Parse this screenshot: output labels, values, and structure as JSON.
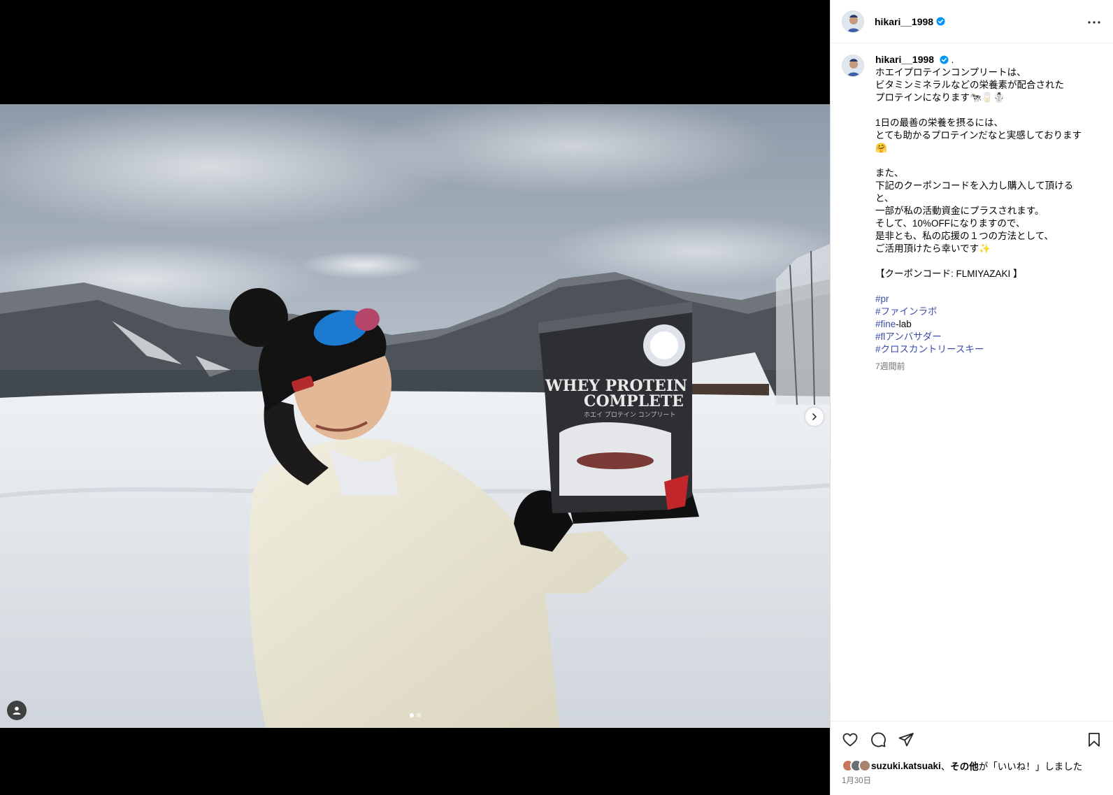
{
  "post": {
    "username": "hikari__1998",
    "verified": true,
    "more_icon": "more-horizontal-icon"
  },
  "media": {
    "description_icons": [
      "chevron-right-icon",
      "user-tag-icon"
    ],
    "carousel": {
      "current": 1,
      "total": 2
    },
    "product_lines": [
      "WHEY PROTEIN",
      "COMPLETE",
      "ホエイ プロテイン コンプリート"
    ]
  },
  "caption": {
    "username": "hikari__1998",
    "separator": ".",
    "text": "ホエイプロテインコンプリートは、\nビタミンミネラルなどの栄養素が配合された\nプロテインになります🐄🥛☃️\n\n1日の最善の栄養を摂るには、\nとても助かるプロテインだなと実感しております\n🤗\n\nまた、\n下記のクーポンコードを入力し購入して頂ける\nと、\n一部が私の活動資金にプラスされます。\nそして、10%OFFになりますので、\n是非とも、私の応援の１つの方法として、\nご活用頂けたら幸いです✨\n\n【クーポンコード: FLMIYAZAKI 】",
    "hashtags": [
      {
        "tag": "#pr",
        "suffix": ""
      },
      {
        "tag": "#ファインラボ",
        "suffix": ""
      },
      {
        "tag": "#fine",
        "suffix": "-lab"
      },
      {
        "tag": "#flアンバサダー",
        "suffix": ""
      },
      {
        "tag": "#クロスカントリースキー",
        "suffix": ""
      }
    ],
    "age": "7週間前"
  },
  "actions": {
    "icons": [
      "heart-icon",
      "comment-icon",
      "share-icon",
      "bookmark-icon"
    ]
  },
  "likes": {
    "user": "suzuki.katsuaki",
    "sep": "、",
    "others": "その他",
    "suffix": "が「いいね！」しました"
  },
  "date": "1月30日",
  "colors": {
    "link": "#3b4da8",
    "verified": "#0095f6",
    "muted": "#737373"
  }
}
